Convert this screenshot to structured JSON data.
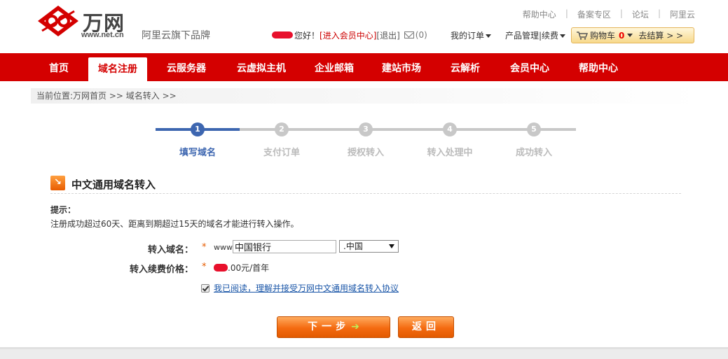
{
  "brand": {
    "name": "万网",
    "url": "www.net.cn",
    "slogan": "阿里云旗下品牌",
    "logo_icon": "wanwang-logo-icon"
  },
  "toplinks": [
    "帮助中心",
    "备案专区",
    "论坛",
    "阿里云"
  ],
  "userbar": {
    "greeting": "您好！",
    "member_center": "[进入会员中心]",
    "logout": "[退出]",
    "mail_icon": "mail-icon",
    "mail_count": "(0)"
  },
  "menus": {
    "orders": "我的订单",
    "products": "产品管理|续费"
  },
  "cart": {
    "label": "购物车",
    "count": "0",
    "checkout": "去结算 > >",
    "icon": "cart-icon"
  },
  "nav": {
    "items": [
      "首页",
      "域名注册",
      "云服务器",
      "云虚拟主机",
      "企业邮箱",
      "建站市场",
      "云解析",
      "会员中心",
      "帮助中心"
    ],
    "active": "域名注册",
    "color": "#d40000"
  },
  "breadcrumb": "当前位置:万网首页 >> 域名转入 >>",
  "steps": {
    "active_index": 0,
    "items": [
      {
        "num": "1",
        "label": "填写域名"
      },
      {
        "num": "2",
        "label": "支付订单"
      },
      {
        "num": "3",
        "label": "授权转入"
      },
      {
        "num": "4",
        "label": "转入处理中"
      },
      {
        "num": "5",
        "label": "成功转入"
      }
    ],
    "active_color": "#3d66b0",
    "inactive_color": "#c8c8c8"
  },
  "section": {
    "title": "中文通用域名转入",
    "icon": "arrow-right-icon"
  },
  "tip": {
    "title": "提示：",
    "text": "注册成功超过60天、距离到期超过15天的域名才能进行转入操作。"
  },
  "form": {
    "domain_label": "转入域名：",
    "required_mark": "*",
    "prefix": "www.",
    "domain_value": "中国银行",
    "suffix_selected": ".中国",
    "price_label": "转入续费价格：",
    "price_suffix": ".00元/首年",
    "agree_checked": true,
    "agree_text": "我已阅读，理解并接受万网中文通用域名转入协议"
  },
  "buttons": {
    "next": "下一步",
    "next_icon": "arrow-right-icon",
    "back": "返回"
  },
  "colors": {
    "accent": "#d40000",
    "button": "#f46a10",
    "link": "#1a56a8"
  }
}
